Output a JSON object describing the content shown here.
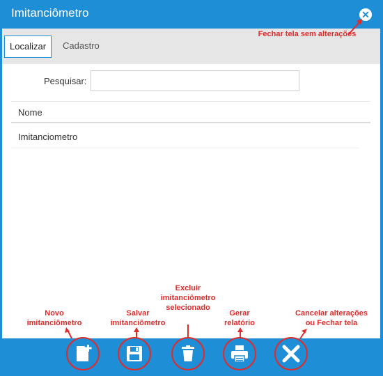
{
  "window": {
    "title": "Imitanciômetro"
  },
  "tabs": [
    {
      "label": "Localizar",
      "active": true
    },
    {
      "label": "Cadastro",
      "active": false
    }
  ],
  "search": {
    "label": "Pesquisar:",
    "value": ""
  },
  "table": {
    "columns": [
      "Nome"
    ],
    "rows": [
      "Imitanciometro"
    ]
  },
  "annotations": {
    "close": "Fechar tela sem alterações",
    "new": [
      "Novo",
      "imitanciômetro"
    ],
    "save": [
      "Salvar",
      "imitanciômetro"
    ],
    "delete": [
      "Excluir",
      "imitanciômetro",
      "selecionado"
    ],
    "report": [
      "Gerar",
      "relatório"
    ],
    "cancel": [
      "Cancelar alterações",
      "ou Fechar tela"
    ]
  },
  "toolbar": {
    "icons": [
      "new-document-icon",
      "save-icon",
      "trash-icon",
      "printer-icon",
      "close-icon"
    ]
  },
  "colors": {
    "accent": "#1e8ed6",
    "annotation": "#e02b2b",
    "tabbar": "#e6e6e6"
  }
}
